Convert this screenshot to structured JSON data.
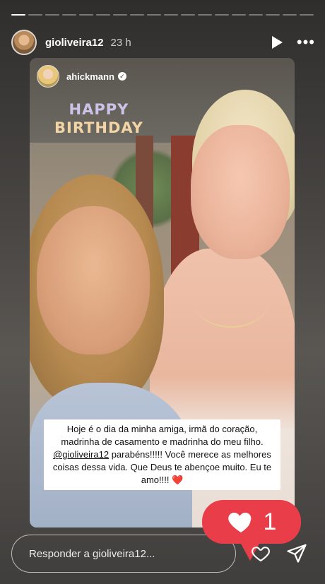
{
  "progress": {
    "segments": 18,
    "active_index": 0
  },
  "header": {
    "username": "gioliveira12",
    "time_ago": "23 h",
    "play_icon": "play-icon",
    "more_icon": "more-icon"
  },
  "repost": {
    "username": "ahickmann",
    "verified": true
  },
  "sticker": {
    "line1": "HAPPY",
    "line2": "BIRTHDAY"
  },
  "caption": {
    "part1": "Hoje é o dia da minha amiga, irmã do coração, madrinha de casamento e madrinha do meu filho. ",
    "mention": "@gioliveira12",
    "part2": " parabéns!!!!! Você merece as melhores coisas dessa vida. Que Deus te abençoe muito. Eu te amo!!!! ",
    "emoji": "❤️"
  },
  "reply": {
    "placeholder": "Responder a gioliveira12..."
  },
  "likes": {
    "count": "1",
    "color": "#ea3d4a"
  }
}
